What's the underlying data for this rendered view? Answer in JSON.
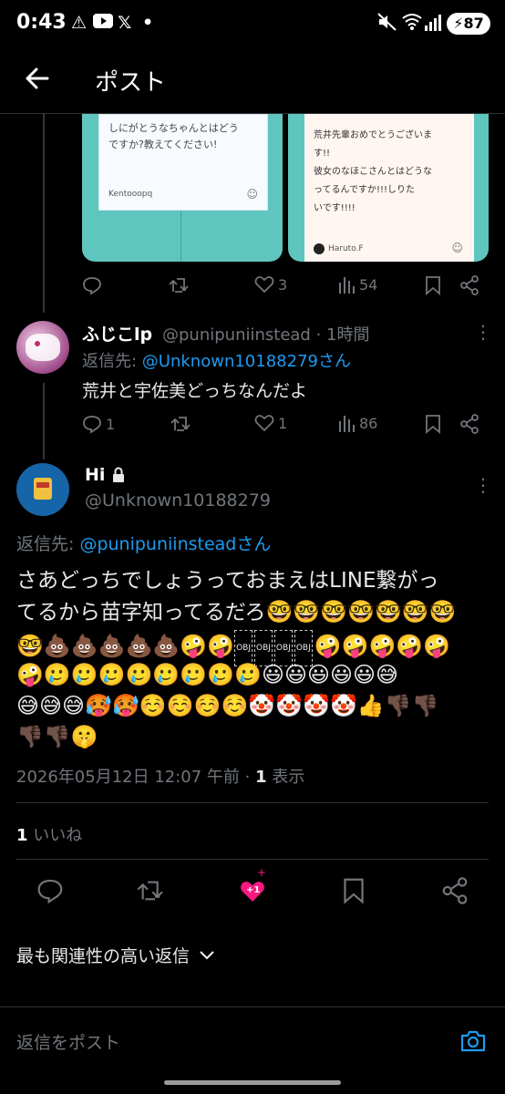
{
  "status_bar": {
    "time": "0:43",
    "battery": "87"
  },
  "header": {
    "title": "ポスト"
  },
  "prev_post_actions": {
    "replies": "",
    "retweets": "",
    "likes": "3",
    "views": "54"
  },
  "images": {
    "left_text": "しにがとうなちゃんとはどう\nですか?教えてください!",
    "left_author": "Kentooopq",
    "right_text": "荒井先輩おめでとうございま\nす!!\n彼女のなほこさんとはどうな\nってるんですか!!!しりた\nいです!!!!",
    "right_author": "Haruto.F"
  },
  "reply": {
    "display_name": "ふじこlp",
    "handle_time": "@punipuniinstead · 1時間",
    "reply_to_prefix": "返信先: ",
    "reply_to_user": "@Unknown10188279さん",
    "text": "荒井と宇佐美どっちなんだよ",
    "replies": "1",
    "retweets": "",
    "likes": "1",
    "views": "86"
  },
  "main_post": {
    "display_name": "Hi",
    "handle": "@Unknown10188279",
    "reply_to_prefix": "返信先: ",
    "reply_to_user": "@punipuniinsteadさん",
    "text_line1": "さあどっちでしょうっておまえはLINE繋がっ",
    "text_line2": "てるから苗字知ってるだろ",
    "emoji_row1": "🤓🤓🤓🤓🤓🤓🤓",
    "emoji_row2": "🤓💩💩💩💩💩🤪🤪",
    "emoji_row2b": "🤪🤪🤪🤪🤪",
    "obj_tokens": [
      "OBJ",
      "OBJ",
      "OBJ",
      "OBJ"
    ],
    "emoji_row3": "🤪🥲🥲🥲🥲🥲🥲🥲🥲😃😃😃😃😃😅",
    "emoji_row4": "😅😅😅🥵🥵☺️☺️☺️☺️🤡🤡🤡🤡👍👎🏿👎🏿",
    "emoji_row5": "👎🏿👎🏿🤫",
    "timestamp": "2026年05月12日 12:07 午前",
    "views_count": "1",
    "views_label": "表示",
    "likes_count": "1",
    "likes_label": "いいね",
    "like_plus": "+1"
  },
  "sort": {
    "label": "最も関連性の高い返信"
  },
  "compose": {
    "placeholder": "返信をポスト"
  },
  "colors": {
    "accent": "#1d9bf0",
    "like_pink": "#f91880",
    "image_teal": "#5fc6bf"
  }
}
